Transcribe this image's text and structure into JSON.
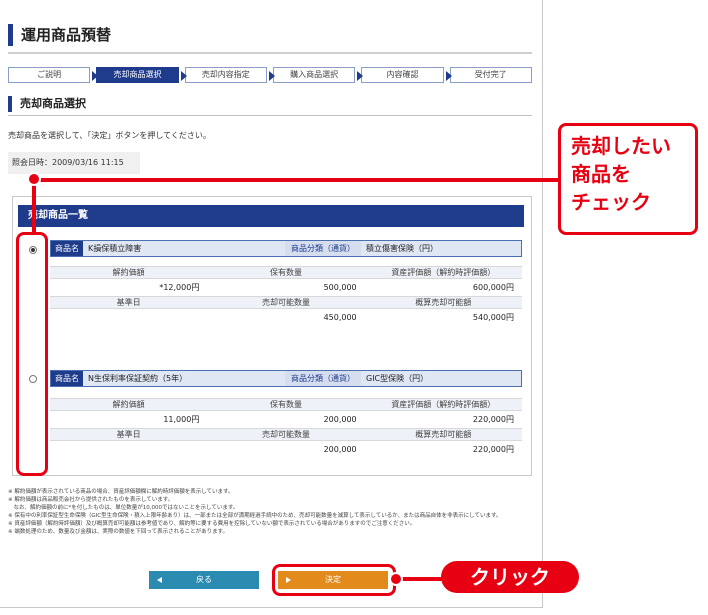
{
  "page_title": "運用商品預替",
  "steps": [
    {
      "label": "ご説明",
      "active": false
    },
    {
      "label": "売却商品選択",
      "active": true
    },
    {
      "label": "売却内容指定",
      "active": false
    },
    {
      "label": "購入商品選択",
      "active": false
    },
    {
      "label": "内容確認",
      "active": false
    },
    {
      "label": "受付完了",
      "active": false
    }
  ],
  "section_title": "売却商品選択",
  "instruction": "売却商品を選択して、「決定」ボタンを押してください。",
  "ref_date": "照会日時：2009/03/16 11:15",
  "list_title": "売却商品一覧",
  "products": [
    {
      "selected": true,
      "name_label": "商品名",
      "name": "K損保積立障害",
      "cat_label": "商品分類（通貨）",
      "category": "積立傷害保険（円）",
      "h1": "解約価額",
      "h2": "保有数量",
      "h3": "資産評価額（解約時評価額）",
      "v1": "*12,000円",
      "v2": "500,000",
      "v3": "600,000円",
      "h4": "基準日",
      "h5": "売却可能数量",
      "h6": "概算売却可能額",
      "v4": "",
      "v5": "450,000",
      "v6": "540,000円"
    },
    {
      "selected": false,
      "name_label": "商品名",
      "name": "N生保利率保証契約（5年）",
      "cat_label": "商品分類（通貨）",
      "category": "GIC型保険（円）",
      "h1": "解約価額",
      "h2": "保有数量",
      "h3": "資産評価額（解約時評価額）",
      "v1": "11,000円",
      "v2": "200,000",
      "v3": "220,000円",
      "h4": "基準日",
      "h5": "売却可能数量",
      "h6": "概算売却可能額",
      "v4": "",
      "v5": "200,000",
      "v6": "220,000円"
    }
  ],
  "notes": [
    "※ 解約価額が表示されている商品の場合、資産評価額欄に解約時評価額を表示しています。",
    "※ 解約価額は商品販売会社から提供されたものを表示しています。",
    "　なお、解約価額の前に*を付したものは、単位数量が10,000ではないことを示しています。",
    "※ 保有中の利率保証型生命保険（GIC型生命保険・積入上限年齢あり）は、一部または全部が満期経過手続中のため、売却可能数量を減算して表示しているか、または商品自体を非表示にしています。",
    "※ 資産評価額（解約時評価額）及び概算売却可能額は参考値であり、解約等に要する費用を控除していない額で表示されている場合がありますのでご注意ください。",
    "※ 端数処理のため、数量及び金額は、実際の数値を下回って表示されることがあります。"
  ],
  "back_label": "戻る",
  "ok_label": "決定",
  "callout_lines": [
    "売却したい",
    "商品を",
    "チェック"
  ],
  "click_label": "クリック",
  "colors": {
    "navy": "#1f3c8c",
    "accent_red": "#e60012",
    "ok_orange": "#e28a1c",
    "back_blue": "#2b8ab0"
  }
}
